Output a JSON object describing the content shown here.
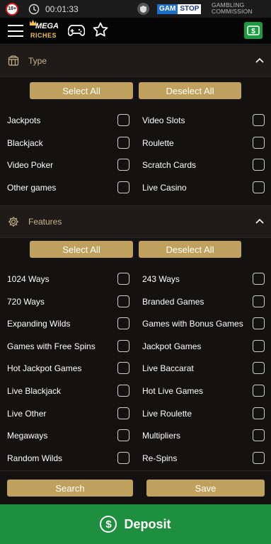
{
  "status_bar": {
    "age_badge": "18+",
    "timer": "00:01:33",
    "gamstop_left": "GAM",
    "gamstop_right": "STOP",
    "commission_line1": "GAMBLING",
    "commission_line2": "COMMISSION"
  },
  "nav": {
    "logo_top": "MEGA",
    "logo_bottom": "RICHES"
  },
  "type_section": {
    "title": "Type",
    "select_all": "Select All",
    "deselect_all": "Deselect All",
    "options": [
      {
        "label": "Jackpots",
        "checked": false
      },
      {
        "label": "Video Slots",
        "checked": false
      },
      {
        "label": "Blackjack",
        "checked": false
      },
      {
        "label": "Roulette",
        "checked": false
      },
      {
        "label": "Video Poker",
        "checked": false
      },
      {
        "label": "Scratch Cards",
        "checked": false
      },
      {
        "label": "Other games",
        "checked": false
      },
      {
        "label": "Live Casino",
        "checked": false
      }
    ]
  },
  "features_section": {
    "title": "Features",
    "select_all": "Select All",
    "deselect_all": "Deselect All",
    "options": [
      {
        "label": "1024 Ways",
        "checked": false
      },
      {
        "label": "243 Ways",
        "checked": false
      },
      {
        "label": "720 Ways",
        "checked": false
      },
      {
        "label": "Branded Games",
        "checked": false
      },
      {
        "label": "Expanding Wilds",
        "checked": false
      },
      {
        "label": "Games with Bonus Games",
        "checked": false
      },
      {
        "label": "Games with Free Spins",
        "checked": false
      },
      {
        "label": "Jackpot Games",
        "checked": false
      },
      {
        "label": "Hot Jackpot Games",
        "checked": false
      },
      {
        "label": "Live Baccarat",
        "checked": false
      },
      {
        "label": "Live Blackjack",
        "checked": false
      },
      {
        "label": "Hot Live Games",
        "checked": false
      },
      {
        "label": "Live Other",
        "checked": false
      },
      {
        "label": "Live Roulette",
        "checked": false
      },
      {
        "label": "Megaways",
        "checked": false
      },
      {
        "label": "Multipliers",
        "checked": false
      },
      {
        "label": "Random Wilds",
        "checked": false
      },
      {
        "label": "Re-Spins",
        "checked": false
      }
    ]
  },
  "actions": {
    "search": "Search",
    "save": "Save"
  },
  "deposit": {
    "label": "Deposit",
    "icon_glyph": "$"
  },
  "colors": {
    "accent_gold": "#bfa15d",
    "deposit_green": "#1e8f3e",
    "background": "#141210"
  }
}
